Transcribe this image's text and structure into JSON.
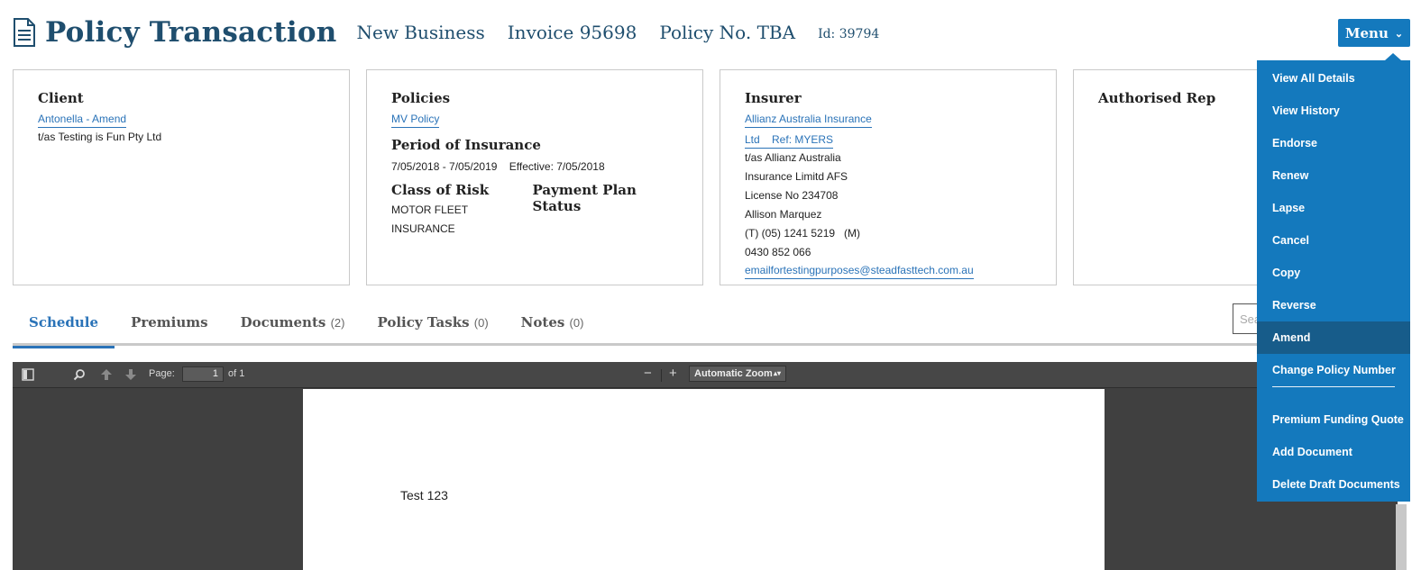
{
  "header": {
    "title": "Policy Transaction",
    "transaction_type": "New Business",
    "invoice": "Invoice 95698",
    "policy_no": "Policy No. TBA",
    "id": "Id: 39794",
    "menu_label": "Menu"
  },
  "cards": {
    "client": {
      "heading": "Client",
      "name_link": "Antonella - Amend",
      "trading_as": "t/as Testing is Fun Pty Ltd"
    },
    "policies": {
      "heading": "Policies",
      "policy_link": "MV Policy",
      "period_heading": "Period of Insurance",
      "period_value": "7/05/2018 - 7/05/2019    Effective: 7/05/2018",
      "class_heading": "Class of Risk",
      "class_value": "MOTOR FLEET INSURANCE",
      "payment_heading": "Payment Plan Status"
    },
    "insurer": {
      "heading": "Insurer",
      "name_link_line1": "Allianz Australia Insurance",
      "name_link_line2": "Ltd    Ref: MYERS",
      "line1": "t/as Allianz Australia",
      "line2": "Insurance Limitd AFS",
      "line3": "License No 234708",
      "line4": "Allison Marquez",
      "line5": "(T) (05) 1241 5219   (M)",
      "line6": "0430 852 066",
      "email_link": "emailfortestingpurposes@steadfasttech.com.au"
    },
    "authorised_rep": {
      "heading": "Authorised Rep"
    }
  },
  "tabs": [
    {
      "label": "Schedule",
      "count": ""
    },
    {
      "label": "Premiums",
      "count": ""
    },
    {
      "label": "Documents",
      "count": "(2)"
    },
    {
      "label": "Policy Tasks",
      "count": "(0)"
    },
    {
      "label": "Notes",
      "count": "(0)"
    }
  ],
  "search": {
    "placeholder": "Sea"
  },
  "viewer": {
    "page_label": "Page:",
    "page_value": "1",
    "page_of": "of 1",
    "zoom_out": "−",
    "zoom_in": "+",
    "zoom_value": "Automatic Zoom",
    "document_text": "Test 123"
  },
  "menu_items": [
    "View All Details",
    "View History",
    "Endorse",
    "Renew",
    "Lapse",
    "Cancel",
    "Copy",
    "Reverse",
    "Amend",
    "Change Policy Number",
    "Premium Funding Quote",
    "Add Document",
    "Delete Draft Documents"
  ],
  "colors": {
    "accent": "#1479bd",
    "menu_active": "#175c8a",
    "title": "#1f4e6e",
    "link": "#2a73b8"
  }
}
